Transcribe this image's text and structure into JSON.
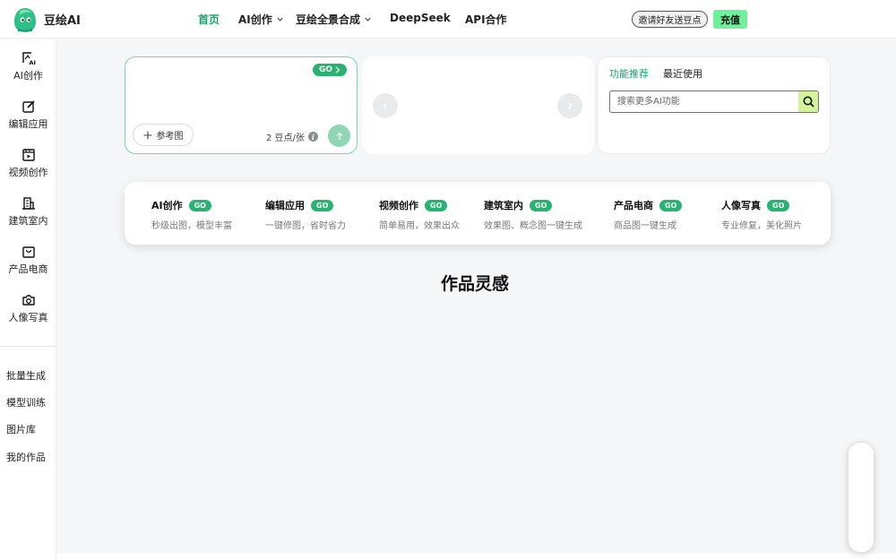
{
  "header": {
    "brand": "豆绘AI",
    "nav": [
      {
        "label": "首页",
        "active": true,
        "dropdown": false
      },
      {
        "label": "AI创作",
        "active": false,
        "dropdown": true
      },
      {
        "label": "豆绘全景合成",
        "active": false,
        "dropdown": true
      },
      {
        "label": "DeepSeek",
        "active": false,
        "dropdown": false
      },
      {
        "label": "API合作",
        "active": false,
        "dropdown": false
      }
    ],
    "invite_label": "邀请好友送豆点",
    "recharge_label": "充值"
  },
  "sidebar": {
    "items": [
      {
        "label": "AI创作",
        "icon": "ai-create-icon"
      },
      {
        "label": "编辑应用",
        "icon": "edit-icon"
      },
      {
        "label": "视频创作",
        "icon": "video-icon"
      },
      {
        "label": "建筑室内",
        "icon": "building-icon"
      },
      {
        "label": "产品电商",
        "icon": "shopping-bag-icon"
      },
      {
        "label": "人像写真",
        "icon": "camera-icon"
      }
    ],
    "links": [
      "批量生成",
      "模型训练",
      "图片库",
      "我的作品"
    ]
  },
  "prompt": {
    "go_label": "GO",
    "reference_label": "参考图",
    "cost_label": "2 豆点/张"
  },
  "features": {
    "tabs": [
      "功能推荐",
      "最近使用"
    ],
    "active_tab": 0,
    "search_placeholder": "搜索更多AI功能"
  },
  "categories": [
    {
      "title": "AI创作",
      "go": "GO",
      "subtitle": "秒级出图，模型丰富"
    },
    {
      "title": "编辑应用",
      "go": "GO",
      "subtitle": "一键修图，省时省力"
    },
    {
      "title": "视频创作",
      "go": "GO",
      "subtitle": "简单易用，效果出众"
    },
    {
      "title": "建筑室内",
      "go": "GO",
      "subtitle": "效果图、概念图一键生成"
    },
    {
      "title": "产品电商",
      "go": "GO",
      "subtitle": "商品图一键生成"
    },
    {
      "title": "人像写真",
      "go": "GO",
      "subtitle": "专业修复，美化照片"
    }
  ],
  "section_title": "作品灵感",
  "colors": {
    "accent": "#1aa36d",
    "go_badge": "#29b372",
    "recharge": "#6ff09b",
    "search_button": "#d4f49a"
  }
}
